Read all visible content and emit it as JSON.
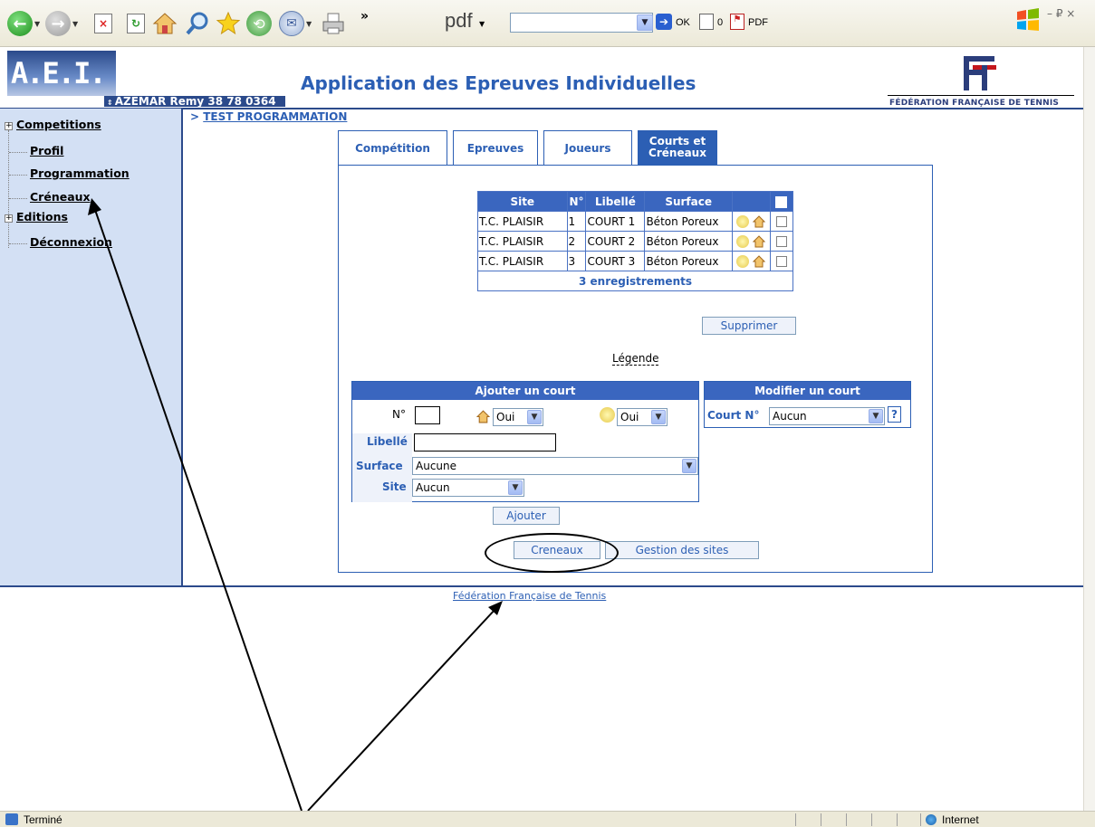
{
  "browser": {
    "pdf_label": "pdf",
    "pdf_search_value": "",
    "ok_label": "OK",
    "counter_label": "0",
    "pdf_button_label": "PDF",
    "chevron": "»",
    "status_text": "Terminé",
    "zone_text": "Internet",
    "window_controls": "– ₽ ×"
  },
  "header": {
    "logo_text": "A.E.I.",
    "user_info": "AZEMAR Remy 38 78 0364",
    "app_title": "Application des Epreuves Individuelles",
    "org_name": "FÉDÉRATION FRANÇAISE DE TENNIS"
  },
  "sidebar": {
    "items": [
      {
        "label": "Competitions",
        "expandable": true
      },
      {
        "label": "Profil"
      },
      {
        "label": "Programmation"
      },
      {
        "label": "Créneaux"
      },
      {
        "label": "Editions",
        "expandable": true
      },
      {
        "label": "Déconnexion"
      }
    ]
  },
  "breadcrumb": {
    "prefix": ">",
    "label": "TEST PROGRAMMATION"
  },
  "tabs": [
    {
      "label": "Compétition"
    },
    {
      "label": "Epreuves"
    },
    {
      "label": "Joueurs"
    },
    {
      "label": "Courts et Créneaux",
      "active": true
    }
  ],
  "courts": {
    "columns": [
      "Site",
      "N°",
      "Libellé",
      "Surface"
    ],
    "rows": [
      {
        "site": "T.C. PLAISIR",
        "num": "1",
        "libelle": "COURT 1",
        "surface": "Béton Poreux"
      },
      {
        "site": "T.C. PLAISIR",
        "num": "2",
        "libelle": "COURT 2",
        "surface": "Béton Poreux"
      },
      {
        "site": "T.C. PLAISIR",
        "num": "3",
        "libelle": "COURT 3",
        "surface": "Béton Poreux"
      }
    ],
    "footer": "3 enregistrements",
    "delete_label": "Supprimer"
  },
  "legend_label": "Légende",
  "add_court": {
    "title": "Ajouter un court",
    "num_label": "N°",
    "num_value": "",
    "covered_value": "Oui",
    "lit_value": "Oui",
    "libelle_label": "Libellé",
    "libelle_value": "",
    "surface_label": "Surface",
    "surface_value": "Aucune",
    "site_label": "Site",
    "site_value": "Aucun",
    "submit_label": "Ajouter"
  },
  "modify_court": {
    "title": "Modifier un court",
    "court_label": "Court N°",
    "court_value": "Aucun",
    "help": "?"
  },
  "actions": {
    "creneaux_label": "Creneaux",
    "sites_label": "Gestion des sites"
  },
  "footer_link": "Fédération Française de Tennis"
}
